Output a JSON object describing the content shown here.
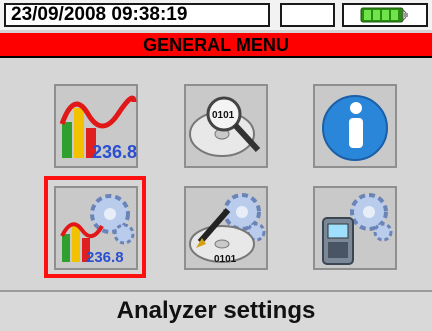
{
  "status": {
    "datetime": "23/09/2008 09:38:19",
    "battery_icon": "battery-full-icon"
  },
  "title": "GENERAL MENU",
  "menu_items": [
    {
      "icon": "analyzer-chart-icon",
      "display_value": "236.8"
    },
    {
      "icon": "recorded-data-disc-icon",
      "display_value": "0101"
    },
    {
      "icon": "info-icon"
    },
    {
      "icon": "analyzer-settings-icon",
      "display_value": "236.8",
      "selected": true
    },
    {
      "icon": "recording-settings-icon",
      "display_value": "0101"
    },
    {
      "icon": "instrument-settings-icon"
    }
  ],
  "selected_label": "Analyzer settings",
  "colors": {
    "title_bar": "#ff0000",
    "selection": "#ff1010",
    "screen_bg": "#d6d6d6",
    "battery_fill": "#3cc21a"
  }
}
